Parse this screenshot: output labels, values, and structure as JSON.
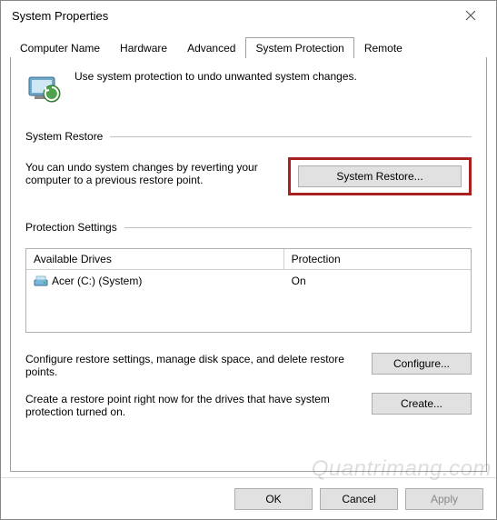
{
  "window": {
    "title": "System Properties"
  },
  "tabs": {
    "items": [
      "Computer Name",
      "Hardware",
      "Advanced",
      "System Protection",
      "Remote"
    ],
    "active_index": 3
  },
  "intro": {
    "text": "Use system protection to undo unwanted system changes."
  },
  "restore": {
    "heading": "System Restore",
    "desc": "You can undo system changes by reverting your computer to a previous restore point.",
    "button": "System Restore..."
  },
  "protection": {
    "heading": "Protection Settings",
    "col_drives": "Available Drives",
    "col_protection": "Protection",
    "rows": [
      {
        "drive": "Acer (C:) (System)",
        "protection": "On"
      }
    ],
    "configure_desc": "Configure restore settings, manage disk space, and delete restore points.",
    "configure_btn": "Configure...",
    "create_desc": "Create a restore point right now for the drives that have system protection turned on.",
    "create_btn": "Create..."
  },
  "buttons": {
    "ok": "OK",
    "cancel": "Cancel",
    "apply": "Apply"
  },
  "watermark": "Quantrimang.com"
}
